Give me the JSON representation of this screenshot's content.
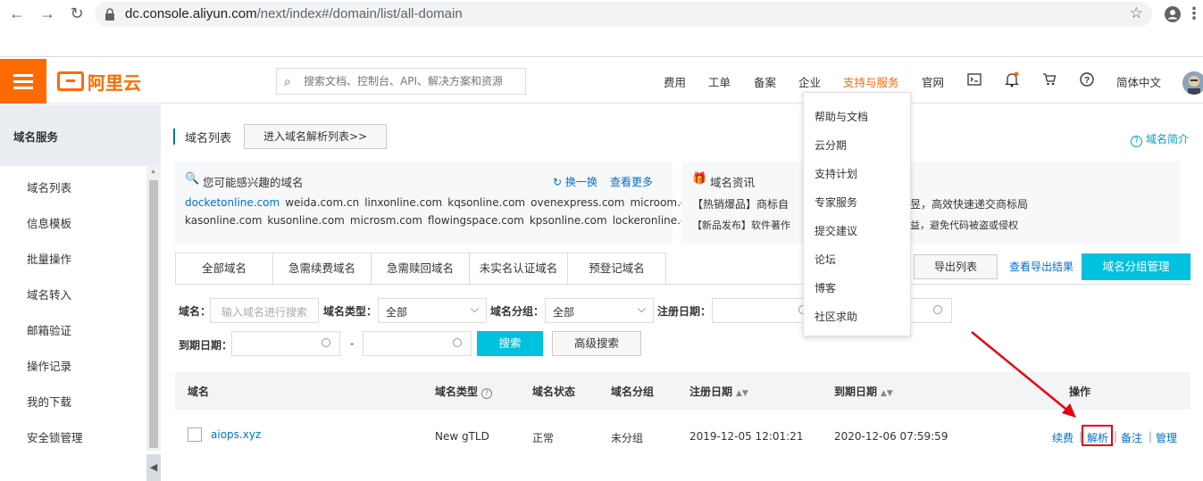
{
  "browser": {
    "url_host": "dc.console.aliyun.com",
    "url_path": "/next/index#/domain/list/all-domain"
  },
  "topbar": {
    "logo_text": "阿里云",
    "search_placeholder": "搜索文档、控制台、API、解决方案和资源",
    "nav": [
      "费用",
      "工单",
      "备案",
      "企业",
      "支持与服务",
      "官网"
    ],
    "active_nav": "支持与服务",
    "language": "简体中文"
  },
  "dropdown": {
    "items": [
      "帮助与文档",
      "云分期",
      "支持计划",
      "专家服务",
      "提交建议",
      "论坛",
      "博客",
      "社区求助"
    ]
  },
  "sidebar": {
    "title": "域名服务",
    "items": [
      "域名列表",
      "信息模板",
      "批量操作",
      "域名转入",
      "邮箱验证",
      "操作记录",
      "我的下载",
      "安全锁管理"
    ]
  },
  "main": {
    "breadcrumb": "域名列表",
    "dns_button": "进入域名解析列表>>",
    "intro_link": "域名简介",
    "interest_card": {
      "title": "您可能感兴趣的域名",
      "refresh": "换一换",
      "more": "查看更多",
      "row1": [
        "docketonline.com",
        "weida.com.cn",
        "linxonline.com",
        "kqsonline.com",
        "ovenexpress.com",
        "microom.com"
      ],
      "row2": [
        "kasonline.com",
        "kusonline.com",
        "microsm.com",
        "flowingspace.com",
        "kpsonline.com",
        "lockeronline.com"
      ]
    },
    "news_card": {
      "title": "域名资讯",
      "line1_left": "【热销爆品】商标自",
      "line1_right": "昱，高效快速递交商标局",
      "line2_left": "【新品发布】软件著作",
      "line2_right": "益，避免代码被盗或侵权"
    },
    "tabs": [
      "全部域名",
      "急需续费域名",
      "急需赎回域名",
      "未实名认证域名",
      "预登记域名"
    ],
    "export_button": "导出列表",
    "export_link": "查看导出结果",
    "group_button": "域名分组管理",
    "filters": {
      "domain_label": "域名：",
      "domain_placeholder": "输入域名进行搜索",
      "type_label": "域名类型：",
      "type_value": "全部",
      "group_label": "域名分组：",
      "group_value": "全部",
      "reg_label": "注册日期：",
      "expire_label": "到期日期：",
      "dash": "-",
      "search_button": "搜索",
      "advanced_button": "高级搜索"
    },
    "table": {
      "headers": [
        "域名",
        "域名类型",
        "域名状态",
        "域名分组",
        "注册日期",
        "到期日期",
        "操作"
      ],
      "rows": [
        {
          "domain": "aiops.xyz",
          "type": "New gTLD",
          "status": "正常",
          "group": "未分组",
          "reg_date": "2019-12-05 12:01:21",
          "expire_date": "2020-12-06 07:59:59",
          "actions": [
            "续费",
            "解析",
            "备注",
            "管理"
          ]
        }
      ]
    }
  },
  "colors": {
    "brand": "#ff6a00",
    "primary": "#00c1de",
    "link": "#0070cc",
    "annotation": "#e60012"
  }
}
